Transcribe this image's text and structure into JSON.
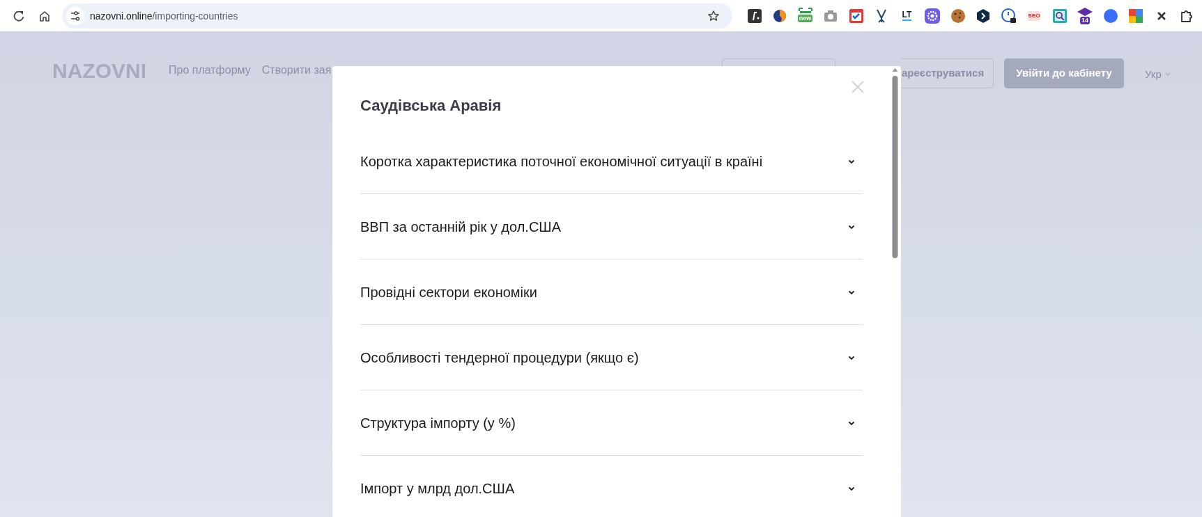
{
  "browser": {
    "url_host": "nazovni.online",
    "url_path": "/importing-countries",
    "extensions": [
      {
        "kind": "f"
      },
      {
        "kind": "dot2"
      },
      {
        "kind": "badge",
        "badge": "new"
      },
      {
        "kind": "camera"
      },
      {
        "kind": "check"
      },
      {
        "kind": "fork"
      },
      {
        "kind": "lt",
        "label": "LT"
      },
      {
        "kind": "gear"
      },
      {
        "kind": "cookie"
      },
      {
        "kind": "hex"
      },
      {
        "kind": "lock"
      },
      {
        "kind": "seo",
        "label": "SEO"
      },
      {
        "kind": "search"
      },
      {
        "kind": "cap",
        "badge": "14"
      },
      {
        "kind": "circle"
      },
      {
        "kind": "google"
      },
      {
        "kind": "x"
      },
      {
        "kind": "puzzle"
      }
    ]
  },
  "header": {
    "logo": "NAZOVNI",
    "nav": [
      "Про платформу",
      "Створити зая"
    ],
    "register": "ареєструватися",
    "login": "Увійти до кабінету",
    "language": "Укр"
  },
  "modal": {
    "title": "Саудівська Аравія",
    "sections": [
      {
        "title": "Коротка характеристика поточної економічної ситуації в країні",
        "expanded": false
      },
      {
        "title": "ВВП за останній рік у дол.США",
        "expanded": false
      },
      {
        "title": "Провідні сектори економіки",
        "expanded": false
      },
      {
        "title": "Особливості тендерної процедури (якщо є)",
        "expanded": false
      },
      {
        "title": "Структура імпорту (у %)",
        "expanded": false
      },
      {
        "title": "Імпорт у млрд дол.США",
        "expanded": false
      }
    ]
  }
}
